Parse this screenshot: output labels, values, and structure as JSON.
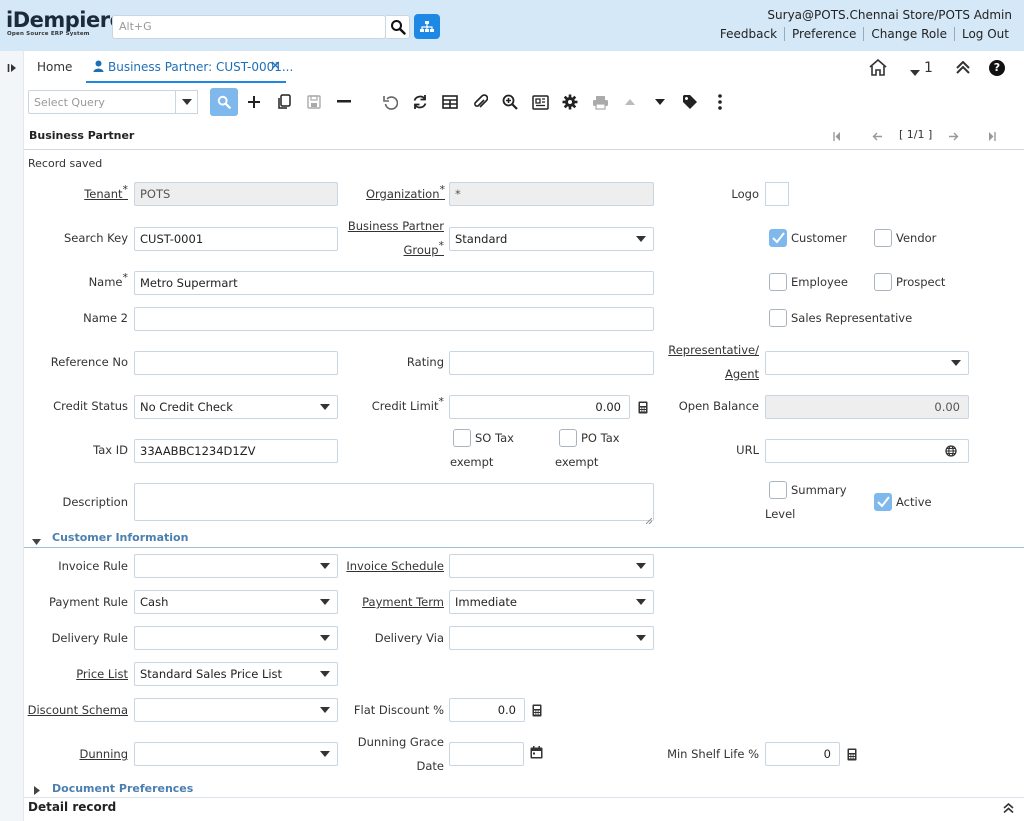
{
  "app": {
    "logo": "iDempiere",
    "logo_sub": "Open Source ERP System",
    "search_placeholder": "Alt+G"
  },
  "user": {
    "info": "Surya@POTS.Chennai Store/POTS Admin",
    "links": [
      "Feedback",
      "Preference",
      "Change Role",
      "Log Out"
    ]
  },
  "tabs": {
    "home": "Home",
    "active": "Business Partner: CUST-0001..."
  },
  "tabbar_right": {
    "window_count": "1"
  },
  "toolbar": {
    "select_query_placeholder": "Select Query"
  },
  "window": {
    "title": "Business Partner",
    "pager": "[ 1/1 ]",
    "status": "Record saved"
  },
  "form": {
    "tenant_label": "Tenant",
    "tenant_value": "POTS",
    "org_label": "Organization",
    "org_value": "*",
    "logo_label": "Logo",
    "search_key_label": "Search Key",
    "search_key_value": "CUST-0001",
    "bp_group_label_1": "Business Partner",
    "bp_group_label_2": "Group",
    "bp_group_value": "Standard",
    "name_label": "Name",
    "name_value": "Metro Supermart",
    "name2_label": "Name 2",
    "name2_value": "",
    "reference_no_label": "Reference No",
    "rating_label": "Rating",
    "rep_label_1": "Representative/",
    "rep_label_2": "Agent",
    "credit_status_label": "Credit Status",
    "credit_status_value": "No Credit Check",
    "credit_limit_label": "Credit Limit",
    "credit_limit_value": "0.00",
    "open_balance_label": "Open Balance",
    "open_balance_value": "0.00",
    "tax_id_label": "Tax ID",
    "tax_id_value": "33AABBC1234D1ZV",
    "so_tax_label_1": "SO Tax",
    "so_tax_label_2": "exempt",
    "po_tax_label_1": "PO Tax",
    "po_tax_label_2": "exempt",
    "url_label": "URL",
    "description_label": "Description",
    "checkboxes": {
      "customer": "Customer",
      "vendor": "Vendor",
      "employee": "Employee",
      "prospect": "Prospect",
      "sales_rep": "Sales Representative",
      "summary_1": "Summary",
      "summary_2": "Level",
      "active": "Active"
    }
  },
  "customer_section": {
    "title": "Customer Information",
    "invoice_rule_label": "Invoice Rule",
    "invoice_schedule_label": "Invoice Schedule",
    "payment_rule_label": "Payment Rule",
    "payment_rule_value": "Cash",
    "payment_term_label": "Payment Term",
    "payment_term_value": "Immediate",
    "delivery_rule_label": "Delivery Rule",
    "delivery_via_label": "Delivery Via",
    "price_list_label": "Price List",
    "price_list_value": "Standard Sales Price List",
    "discount_schema_label": "Discount Schema",
    "flat_discount_label": "Flat Discount %",
    "flat_discount_value": "0.0",
    "dunning_label": "Dunning",
    "dunning_grace_label_1": "Dunning Grace",
    "dunning_grace_label_2": "Date",
    "min_shelf_label": "Min Shelf Life %",
    "min_shelf_value": "0"
  },
  "doc_section": {
    "title": "Document Preferences"
  },
  "detail": {
    "title": "Detail record"
  },
  "colors": {
    "accent": "#1e88e5",
    "header_bg": "#d4e8f8",
    "check_on": "#7fb8ec"
  }
}
